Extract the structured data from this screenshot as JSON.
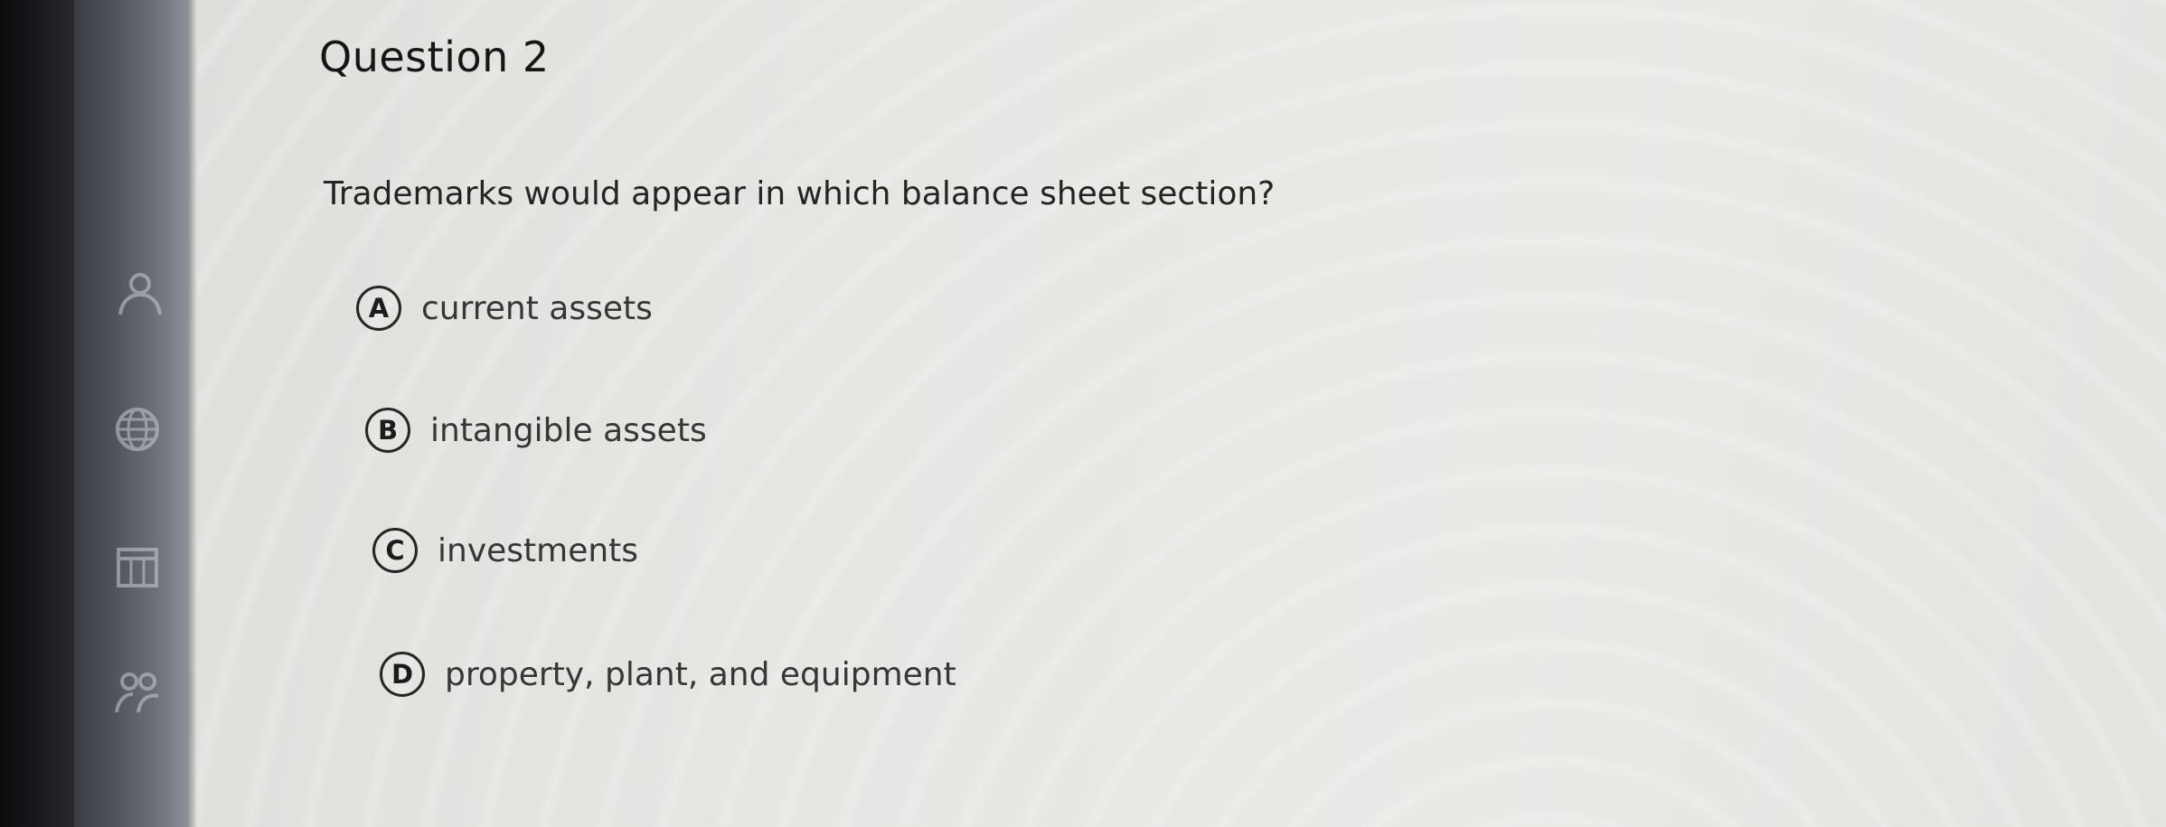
{
  "question": {
    "title": "Question 2",
    "text": "Trademarks would appear in which balance sheet section?"
  },
  "options": [
    {
      "letter": "A",
      "label": "current assets"
    },
    {
      "letter": "B",
      "label": "intangible assets"
    },
    {
      "letter": "C",
      "label": "investments"
    },
    {
      "letter": "D",
      "label": "property, plant, and equipment"
    }
  ],
  "sidebar": {
    "icons": [
      "people-icon",
      "globe-icon",
      "calendar-icon",
      "users-icon"
    ]
  }
}
